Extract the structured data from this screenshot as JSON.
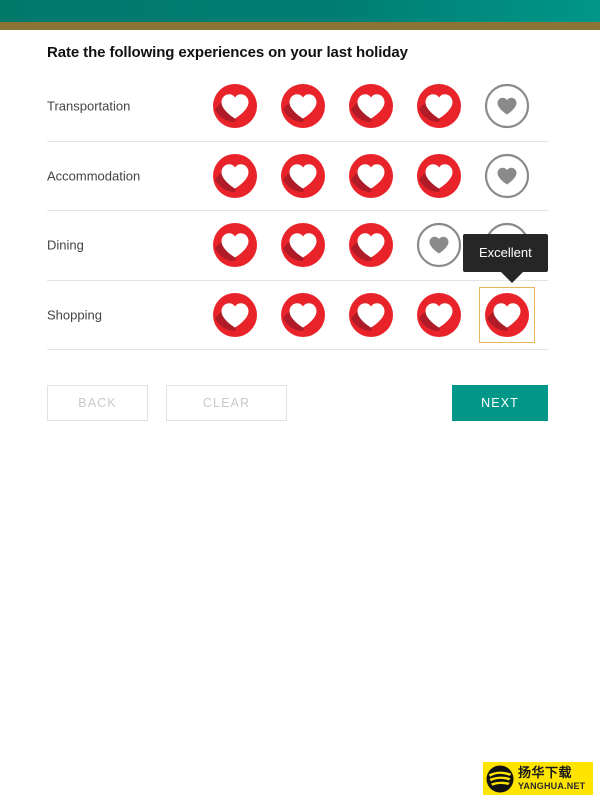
{
  "theme": {
    "header_teal": "#00796B",
    "accent_gold": "#8A7434",
    "heart_red": "#E8232A",
    "heart_shadow_red": "#B01B28",
    "heart_gray": "#8A8A8A",
    "focus_outline": "#E8B45C",
    "next_button_teal": "#009688",
    "disabled_text": "#C9C9C9",
    "tooltip_bg": "#262626"
  },
  "survey": {
    "title": "Rate the following experiences on your last holiday",
    "max_rating": 5,
    "rows": [
      {
        "label": "Transportation",
        "value": 4
      },
      {
        "label": "Accommodation",
        "value": 4
      },
      {
        "label": "Dining",
        "value": 3
      },
      {
        "label": "Shopping",
        "value": 5
      }
    ],
    "focused_cell": {
      "row": 3,
      "index": 4
    },
    "tooltip": {
      "text": "Excellent",
      "for_row": "Shopping",
      "for_index": 5
    }
  },
  "actions": {
    "back_label": "BACK",
    "back_disabled": true,
    "clear_label": "CLEAR",
    "clear_disabled": true,
    "next_label": "NEXT",
    "next_disabled": false
  },
  "watermark": {
    "title_cn": "扬华下载",
    "title_en": "YANGHUA.NET",
    "logo_icon": "tiger-logo-icon"
  }
}
